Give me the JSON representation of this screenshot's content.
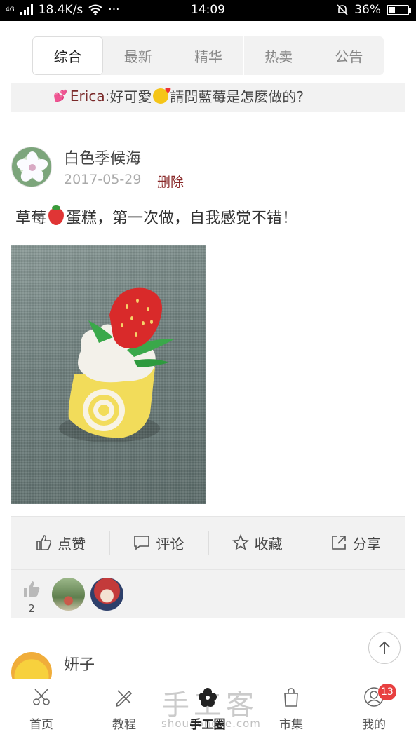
{
  "status_bar": {
    "network": "4G",
    "speed": "18.4K/s",
    "dots": "···",
    "time": "14:09",
    "battery": "36%",
    "battery_level": 0.36
  },
  "tabs": [
    {
      "label": "综合",
      "active": true
    },
    {
      "label": "最新",
      "active": false
    },
    {
      "label": "精华",
      "active": false
    },
    {
      "label": "热卖",
      "active": false
    },
    {
      "label": "公告",
      "active": false
    }
  ],
  "comment_preview": {
    "name": "Erica",
    "sep": ":",
    "text_before": "好可愛",
    "text_after": "請問藍莓是怎麼做的?"
  },
  "post": {
    "author": "白色季候海",
    "date": "2017-05-29",
    "delete_label": "删除",
    "text_before": "草莓",
    "text_after": "蛋糕，第一次做，自我感觉不错！",
    "actions": [
      {
        "label": "点赞",
        "icon": "thumbs-up-icon"
      },
      {
        "label": "评论",
        "icon": "comment-icon"
      },
      {
        "label": "收藏",
        "icon": "star-icon"
      },
      {
        "label": "分享",
        "icon": "share-icon"
      }
    ],
    "like_count": "2"
  },
  "next_post": {
    "author": "妍子"
  },
  "bottom_nav": {
    "watermark": "手工客",
    "watermark_url": "shougongke.com",
    "items": [
      {
        "label": "首页",
        "icon": "scissors-icon"
      },
      {
        "label": "教程",
        "icon": "pencil-ruler-icon"
      },
      {
        "label": "手工圈",
        "icon": "flower-icon",
        "active": true
      },
      {
        "label": "市集",
        "icon": "shopping-bag-icon"
      },
      {
        "label": "我的",
        "icon": "user-icon",
        "badge": "13"
      }
    ]
  }
}
